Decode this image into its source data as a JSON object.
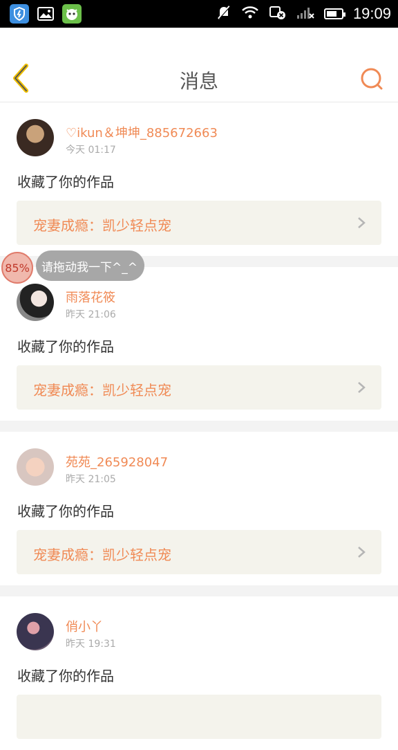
{
  "statusbar": {
    "time": "19:09",
    "icons": [
      "shield-app-icon",
      "gallery-app-icon",
      "game-app-icon",
      "mute-icon",
      "wifi-icon",
      "sim-icon",
      "signal-icon",
      "battery-icon"
    ]
  },
  "header": {
    "title": "消息",
    "accent": "#f08a55"
  },
  "messages": [
    {
      "user": "♡ikun＆坤坤_885672663",
      "time": "今天 01:17",
      "action": "收藏了你的作品",
      "work": "宠妻成瘾：凯少轻点宠"
    },
    {
      "user": "雨落花筱",
      "time": "昨天 21:06",
      "action": "收藏了你的作品",
      "work": "宠妻成瘾：凯少轻点宠"
    },
    {
      "user": "苑苑_265928047",
      "time": "昨天 21:05",
      "action": "收藏了你的作品",
      "work": "宠妻成瘾：凯少轻点宠"
    },
    {
      "user": "俏小丫",
      "time": "昨天 19:31",
      "action": "收藏了你的作品",
      "work": ""
    }
  ],
  "floating": {
    "percent": "85%",
    "tip": "请拖动我一下^_^"
  }
}
